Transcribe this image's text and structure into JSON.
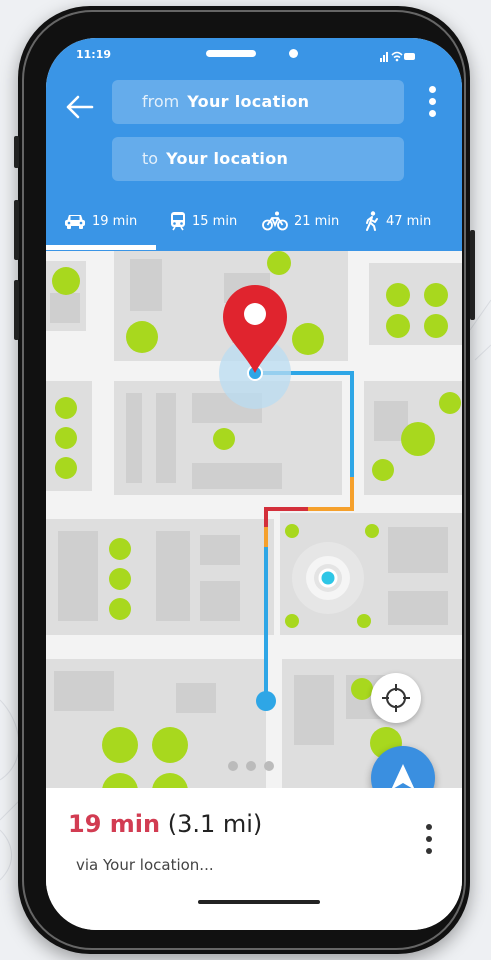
{
  "status_bar": {
    "time": "11:19"
  },
  "route": {
    "from_prefix": "from",
    "from_value": "Your location",
    "to_prefix": "to",
    "to_value": "Your location"
  },
  "modes": [
    {
      "icon": "car-icon",
      "label": "19 min"
    },
    {
      "icon": "train-icon",
      "label": "15 min"
    },
    {
      "icon": "bicycle-icon",
      "label": "21 min"
    },
    {
      "icon": "walk-icon",
      "label": "47 min"
    }
  ],
  "summary": {
    "duration": "19 min",
    "distance": "(3.1 mi)",
    "via": "via Your location..."
  },
  "colors": {
    "header": "#3a95e6",
    "route_blue": "#2ea6e6",
    "route_orange": "#f5a02c",
    "route_red": "#d32f3a",
    "tree_green": "#a8d81e",
    "pin_red": "#e0242e"
  }
}
